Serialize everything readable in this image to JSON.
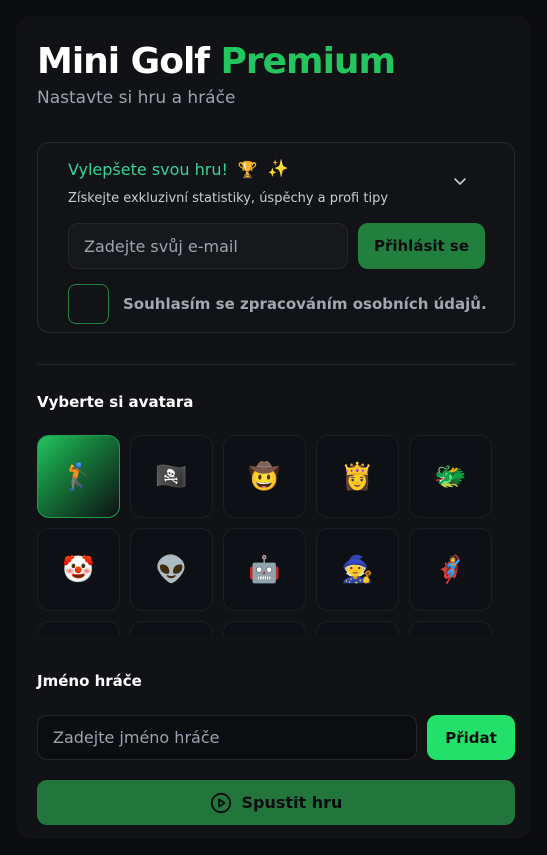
{
  "header": {
    "title_main": "Mini Golf",
    "title_accent": "Premium",
    "subtitle": "Nastavte si hru a hráče"
  },
  "promo": {
    "heading": "Vylepšete svou hru!",
    "heading_emoji": "🏆",
    "sparkle": "✨",
    "description": "Získejte exkluzivní statistiky, úspěchy a profi tipy",
    "email_placeholder": "Zadejte svůj e-mail",
    "login_label": "Přihlásit se",
    "consent_label": "Souhlasím se zpracováním osobních údajů."
  },
  "avatars": {
    "title": "Vyberte si avatara",
    "items": [
      "🏌️",
      "🏴‍☠️",
      "🤠",
      "👸",
      "🐲",
      "🤡",
      "👽",
      "🤖",
      "🧙",
      "🦸"
    ],
    "selected_index": 0
  },
  "player": {
    "title": "Jméno hráče",
    "name_placeholder": "Zadejte jméno hráče",
    "add_label": "Přidat"
  },
  "start": {
    "label": "Spustit hru"
  },
  "colors": {
    "accent": "#22c55e",
    "background": "#0b0c0f",
    "card": "#111216",
    "button_dark_green": "#22803f",
    "button_bright_green": "#22e06a"
  }
}
